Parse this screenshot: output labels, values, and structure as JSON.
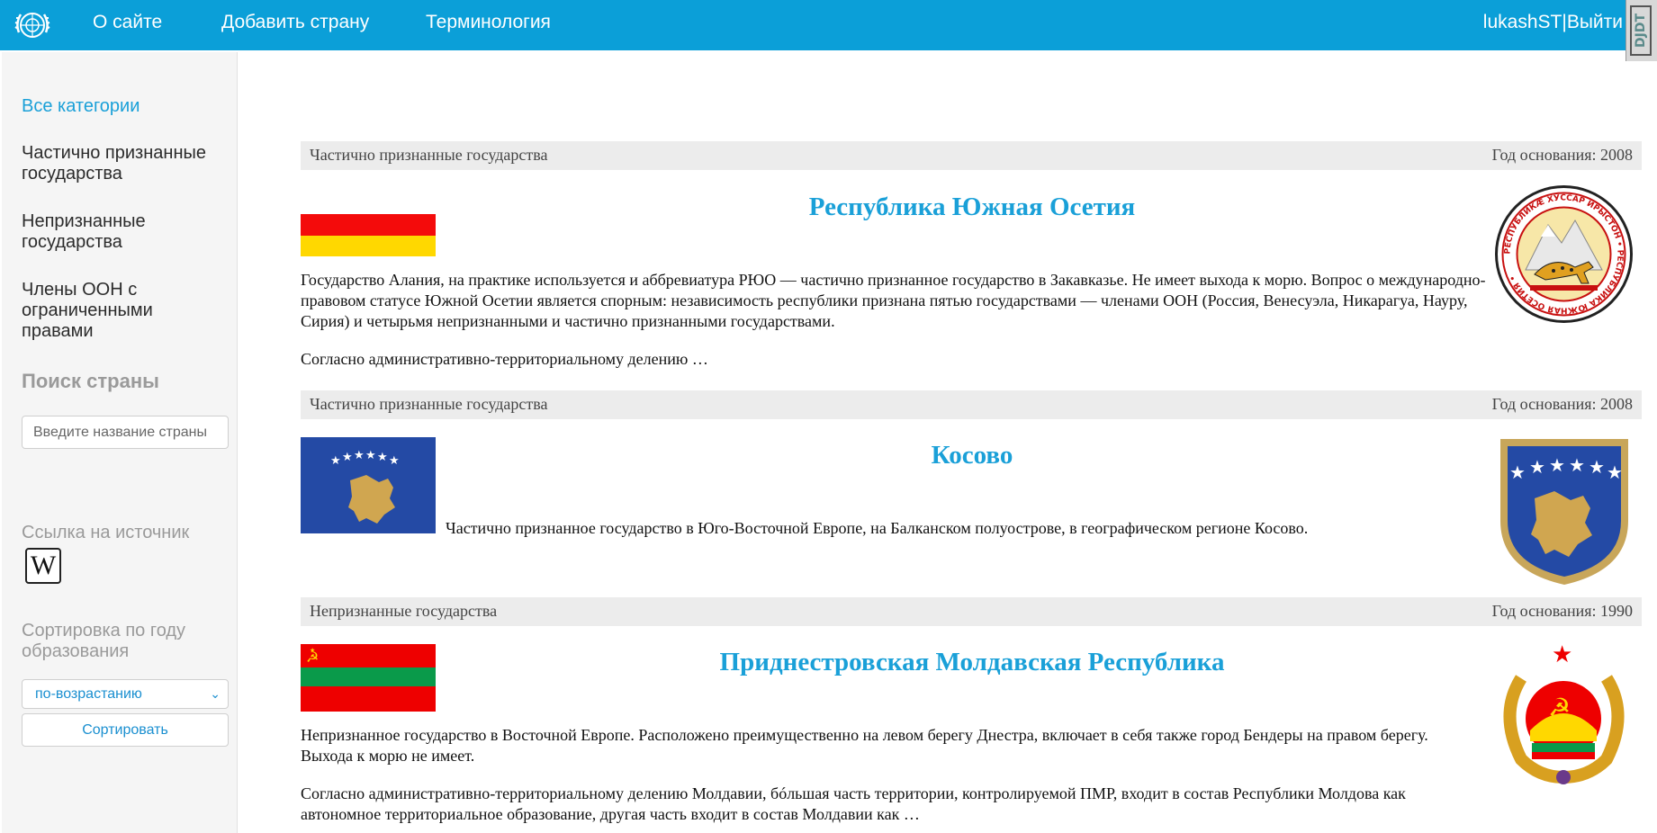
{
  "nav": {
    "items": [
      {
        "label": "О сайте"
      },
      {
        "label": "Добавить страну"
      },
      {
        "label": "Терминология"
      }
    ],
    "user": "lukashST",
    "separator": "|",
    "logout": "Выйти",
    "badge": "DJDT"
  },
  "sidebar": {
    "categories": [
      {
        "label": "Все категории",
        "active": true
      },
      {
        "label": "Частично признанные государства"
      },
      {
        "label": "Непризнанные государства"
      },
      {
        "label": "Члены ООН с ограниченными правами"
      }
    ],
    "search_heading": "Поиск страны",
    "search_placeholder": "Введите название страны",
    "source_label": "Ссылка на источник",
    "wiki_glyph": "W",
    "sort_label": "Сортировка по году образования",
    "sort_selected": "по-возрастанию",
    "sort_button": "Сортировать"
  },
  "colors": {
    "accent": "#0b9fd8",
    "title": "#1aa0d8",
    "header_bg": "#ececec"
  },
  "countries": [
    {
      "category": "Частично признанные государства",
      "year": "Год основания: 2008",
      "title": "Республика Южная Осетия",
      "p1": "Государство Алания, на практике используется и аббревиатура РЮО — частично признанное государство в Закавказье. Не имеет выхода к морю. Вопрос о международно-правовом статусе Южной Осетии является спорным: независимость республики признана пятью государствами — членами ООН (Россия, Венесуэла, Никарагуа, Науру, Сирия) и четырьмя непризнанными и частично признанными государствами.",
      "p2": "Согласно административно-территориальному делению …",
      "emblem_text": "РЕСПУБЛИКӔ ХУССАР ИРЫСТОН • РЕСПУБЛИКА ЮЖНАЯ ОСЕТИЯ •"
    },
    {
      "category": "Частично признанные государства",
      "year": "Год основания: 2008",
      "title": "Косово",
      "p1": "Частично признанное государство в Юго-Восточной Европе, на Балканском полуострове, в географическом регионе Косово."
    },
    {
      "category": "Непризнанные государства",
      "year": "Год основания: 1990",
      "title": "Приднестровская Молдавская Республика",
      "p1": "Непризнанное государство в Восточной Европе. Расположено преимущественно на левом берегу Днестра, включает в себя также город Бендеры на правом берегу. Выхода к морю не имеет.",
      "p2": "Согласно административно-территориальному делению Молдавии, бóльшая часть территории, контролируемой ПМР, входит в состав Республики Молдова как автономное территориальное образование, другая часть входит в состав Молдавии как …"
    }
  ]
}
